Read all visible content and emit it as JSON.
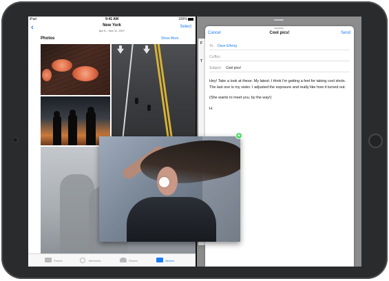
{
  "status_bar": {
    "carrier": "iPad",
    "time": "9:41 AM",
    "battery": "100%"
  },
  "photos_app": {
    "back_icon": "chevron-left-icon",
    "title": "New York",
    "subtitle": "Apr 6 – Nov 11, 2017",
    "select_label": "Select",
    "section_title": "Photos",
    "show_more_label": "Show More",
    "tabs": [
      {
        "label": "Photos",
        "icon": "photos-icon",
        "active": false
      },
      {
        "label": "Memories",
        "icon": "memories-icon",
        "active": false
      },
      {
        "label": "Shared",
        "icon": "cloud-icon",
        "active": false
      },
      {
        "label": "Albums",
        "icon": "albums-icon",
        "active": true
      }
    ]
  },
  "mail_compose": {
    "cancel_label": "Cancel",
    "title": "Cool pics!",
    "send_label": "Send",
    "to_label": "To:",
    "to_value": "Dave Elfving",
    "cc_label": "Cc/Bcc:",
    "subject_label": "Subject:",
    "subject_value": "Cool pics!",
    "body": [
      "Hey! Take a look at these. My latest. I think I'm getting a feel for taking cool shots. The last one is my sister. I adjusted the exposure and really like how it turned out.",
      "(She wants to meet you, by the way!)",
      "H."
    ]
  },
  "drag": {
    "badge_label": "+",
    "badge_color": "#4cd964"
  },
  "colors": {
    "accent": "#1a7cf5",
    "device": "#2a2b2d"
  }
}
